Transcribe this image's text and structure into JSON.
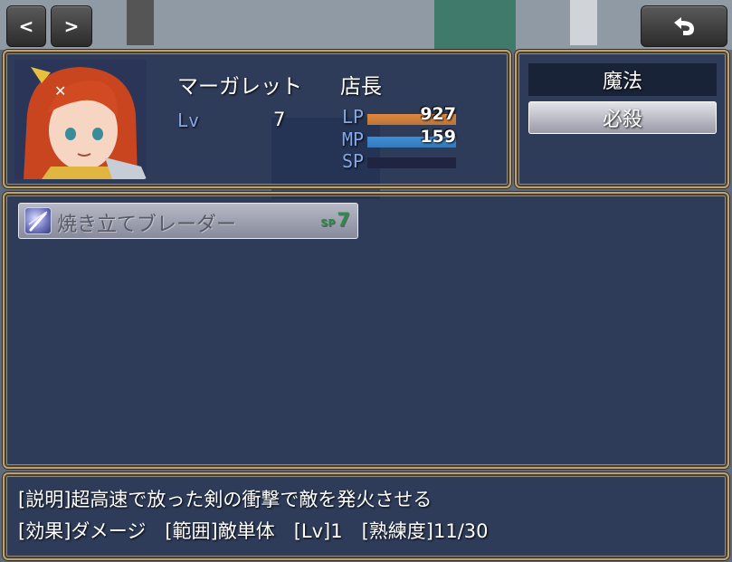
{
  "nav": {
    "prev_label": "<",
    "next_label": ">",
    "back_icon": "undo-arrow-icon"
  },
  "actor": {
    "name": "マーガレット",
    "class": "店長",
    "level_label": "Lv",
    "level": "7",
    "lp": {
      "label": "LP",
      "value": "927",
      "fill": 1.0,
      "color": "#e0883a"
    },
    "mp": {
      "label": "MP",
      "value": "159",
      "fill": 1.0,
      "color": "#3c8ed8"
    },
    "sp": {
      "label": "SP",
      "value": "",
      "fill": 0.0,
      "color": "#2a2f55"
    }
  },
  "commands": [
    {
      "label": "魔法",
      "selected": false
    },
    {
      "label": "必殺",
      "selected": true
    }
  ],
  "skills": [
    {
      "name": "焼き立てブレーダー",
      "cost_label": "SP",
      "cost": "7",
      "icon": "sword-slash-skill-icon"
    }
  ],
  "help": {
    "line1": "[説明]超高速で放った剣の衝撃で敵を発火させる",
    "line2": "[効果]ダメージ　[範囲]敵単体　[Lv]1　[熟練度]11/30"
  }
}
